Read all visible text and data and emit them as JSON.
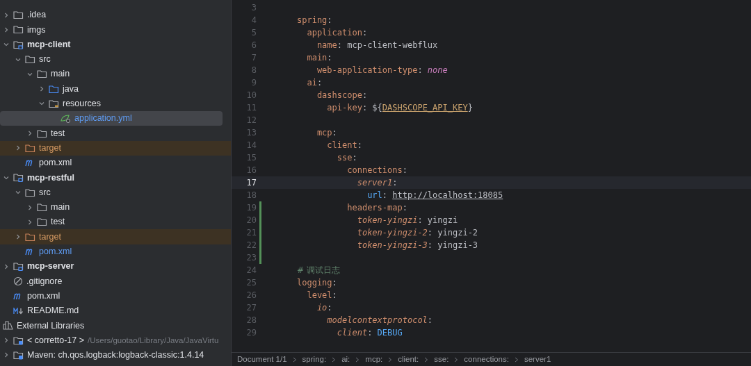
{
  "project_tree": [
    {
      "name": ".idea",
      "kind": "folder",
      "expanded": false
    },
    {
      "name": "imgs",
      "kind": "folder",
      "expanded": false
    },
    {
      "name": "mcp-client",
      "kind": "module",
      "expanded": true,
      "children": [
        {
          "name": "src",
          "kind": "folder",
          "expanded": true,
          "children": [
            {
              "name": "main",
              "kind": "folder",
              "expanded": true,
              "children": [
                {
                  "name": "java",
                  "kind": "source",
                  "expanded": false
                },
                {
                  "name": "resources",
                  "kind": "resources",
                  "expanded": true,
                  "children": [
                    {
                      "name": "application.yml",
                      "kind": "yaml",
                      "selected": true,
                      "modified": true
                    }
                  ]
                }
              ]
            },
            {
              "name": "test",
              "kind": "folder",
              "expanded": false
            }
          ]
        },
        {
          "name": "target",
          "kind": "excluded",
          "expanded": false
        },
        {
          "name": "pom.xml",
          "kind": "maven",
          "selected": false,
          "modified": false
        }
      ]
    },
    {
      "name": "mcp-restful",
      "kind": "module",
      "expanded": true,
      "children": [
        {
          "name": "src",
          "kind": "folder",
          "expanded": true,
          "children": [
            {
              "name": "main",
              "kind": "folder",
              "expanded": false
            },
            {
              "name": "test",
              "kind": "folder",
              "expanded": false
            }
          ]
        },
        {
          "name": "target",
          "kind": "excluded",
          "expanded": false
        },
        {
          "name": "pom.xml",
          "kind": "maven",
          "selected": false,
          "modified": true
        }
      ]
    },
    {
      "name": "mcp-server",
      "kind": "module",
      "expanded": false
    },
    {
      "name": ".gitignore",
      "kind": "ignore",
      "selected": false,
      "modified": false
    },
    {
      "name": "pom.xml",
      "kind": "maven",
      "selected": false,
      "modified": false
    },
    {
      "name": "README.md",
      "kind": "markdown",
      "selected": false,
      "modified": false
    },
    {
      "name": "External Libraries",
      "kind": "libraries"
    },
    {
      "name": "< corretto-17 >",
      "kind": "jdk",
      "expanded": false,
      "note": "/Users/guotao/Library/Java/JavaVirtu"
    },
    {
      "name": "Maven: ch.qos.logback:logback-classic:1.4.14",
      "kind": "library",
      "expanded": false
    }
  ],
  "editor": {
    "lines": [
      {
        "n": "3",
        "current": false,
        "changed": false
      },
      {
        "n": "4",
        "current": false,
        "changed": false,
        "tokens": [
          {
            "kind": "key",
            "text": "spring"
          },
          {
            "kind": "plain",
            "text": ":"
          }
        ],
        "children": [
          {
            "n": "5",
            "current": false,
            "changed": false,
            "tokens": [
              {
                "kind": "key",
                "text": "application"
              },
              {
                "kind": "plain",
                "text": ":"
              }
            ],
            "children": [
              {
                "n": "6",
                "current": false,
                "changed": false,
                "tokens": [
                  {
                    "kind": "key",
                    "text": "name"
                  },
                  {
                    "kind": "plain",
                    "text": ": mcp-client-webflux"
                  }
                ]
              }
            ]
          },
          {
            "n": "7",
            "current": false,
            "changed": false,
            "tokens": [
              {
                "kind": "key",
                "text": "main"
              },
              {
                "kind": "plain",
                "text": ":"
              }
            ],
            "children": [
              {
                "n": "8",
                "current": false,
                "changed": false,
                "tokens": [
                  {
                    "kind": "key",
                    "text": "web-application-type"
                  },
                  {
                    "kind": "plain",
                    "text": ": "
                  },
                  {
                    "kind": "constant",
                    "text": "none"
                  }
                ]
              }
            ]
          },
          {
            "n": "9",
            "current": false,
            "changed": false,
            "tokens": [
              {
                "kind": "key",
                "text": "ai"
              },
              {
                "kind": "plain",
                "text": ":"
              }
            ],
            "children": [
              {
                "n": "10",
                "current": false,
                "changed": false,
                "tokens": [
                  {
                    "kind": "key",
                    "text": "dashscope"
                  },
                  {
                    "kind": "plain",
                    "text": ":"
                  }
                ],
                "children": [
                  {
                    "n": "11",
                    "current": false,
                    "changed": false,
                    "tokens": [
                      {
                        "kind": "key",
                        "text": "api-key"
                      },
                      {
                        "kind": "plain",
                        "text": ": ${"
                      },
                      {
                        "kind": "env",
                        "text": "DASHSCOPE_API_KEY"
                      },
                      {
                        "kind": "plain",
                        "text": "}"
                      }
                    ]
                  }
                ]
              },
              {
                "n": "12",
                "current": false,
                "changed": false
              },
              {
                "n": "13",
                "current": false,
                "changed": false,
                "tokens": [
                  {
                    "kind": "key",
                    "text": "mcp"
                  },
                  {
                    "kind": "plain",
                    "text": ":"
                  }
                ],
                "children": [
                  {
                    "n": "14",
                    "current": false,
                    "changed": false,
                    "tokens": [
                      {
                        "kind": "key",
                        "text": "client"
                      },
                      {
                        "kind": "plain",
                        "text": ":"
                      }
                    ],
                    "children": [
                      {
                        "n": "15",
                        "current": false,
                        "changed": false,
                        "tokens": [
                          {
                            "kind": "key",
                            "text": "sse"
                          },
                          {
                            "kind": "plain",
                            "text": ":"
                          }
                        ],
                        "children": [
                          {
                            "n": "16",
                            "current": false,
                            "changed": false,
                            "tokens": [
                              {
                                "kind": "key",
                                "text": "connections"
                              },
                              {
                                "kind": "plain",
                                "text": ":"
                              }
                            ],
                            "children": [
                              {
                                "n": "17",
                                "current": true,
                                "changed": false,
                                "tokens": [
                                  {
                                    "kind": "italic_key",
                                    "text": "server1"
                                  },
                                  {
                                    "kind": "plain",
                                    "text": ":"
                                  }
                                ],
                                "children": [
                                  {
                                    "n": "18",
                                    "current": false,
                                    "changed": false,
                                    "tokens": [
                                      {
                                        "kind": "property",
                                        "text": "url"
                                      },
                                      {
                                        "kind": "plain",
                                        "text": ": "
                                      },
                                      {
                                        "kind": "link",
                                        "text": "http://localhost:18085"
                                      }
                                    ]
                                  }
                                ]
                              }
                            ]
                          },
                          {
                            "n": "19",
                            "current": false,
                            "changed": true,
                            "tokens": [
                              {
                                "kind": "key",
                                "text": "headers-map"
                              },
                              {
                                "kind": "plain",
                                "text": ":"
                              }
                            ],
                            "children": [
                              {
                                "n": "20",
                                "current": false,
                                "changed": true,
                                "tokens": [
                                  {
                                    "kind": "italic_key",
                                    "text": "token-yingzi"
                                  },
                                  {
                                    "kind": "plain",
                                    "text": ": yingzi"
                                  }
                                ]
                              },
                              {
                                "n": "21",
                                "current": false,
                                "changed": true,
                                "tokens": [
                                  {
                                    "kind": "italic_key",
                                    "text": "token-yingzi-2"
                                  },
                                  {
                                    "kind": "plain",
                                    "text": ": yingzi-2"
                                  }
                                ]
                              },
                              {
                                "n": "22",
                                "current": false,
                                "changed": true,
                                "tokens": [
                                  {
                                    "kind": "italic_key",
                                    "text": "token-yingzi-3"
                                  },
                                  {
                                    "kind": "plain",
                                    "text": ": yingzi-3"
                                  }
                                ]
                              }
                            ]
                          },
                          {
                            "n": "23",
                            "current": false,
                            "changed": true
                          }
                        ]
                      }
                    ]
                  }
                ]
              }
            ]
          }
        ]
      },
      {
        "n": "24",
        "current": false,
        "changed": false,
        "tokens": [
          {
            "kind": "comment",
            "text": "# 调试日志"
          }
        ]
      },
      {
        "n": "25",
        "current": false,
        "changed": false,
        "tokens": [
          {
            "kind": "key",
            "text": "logging"
          },
          {
            "kind": "plain",
            "text": ":"
          }
        ],
        "children": [
          {
            "n": "26",
            "current": false,
            "changed": false,
            "tokens": [
              {
                "kind": "key",
                "text": "level"
              },
              {
                "kind": "plain",
                "text": ":"
              }
            ],
            "children": [
              {
                "n": "27",
                "current": false,
                "changed": false,
                "tokens": [
                  {
                    "kind": "italic_key",
                    "text": "io"
                  },
                  {
                    "kind": "plain",
                    "text": ":"
                  }
                ],
                "children": [
                  {
                    "n": "28",
                    "current": false,
                    "changed": false,
                    "tokens": [
                      {
                        "kind": "italic_key",
                        "text": "modelcontextprotocol"
                      },
                      {
                        "kind": "plain",
                        "text": ":"
                      }
                    ],
                    "children": [
                      {
                        "n": "29",
                        "current": false,
                        "changed": false,
                        "tokens": [
                          {
                            "kind": "italic_key",
                            "text": "client"
                          },
                          {
                            "kind": "plain",
                            "text": ": "
                          },
                          {
                            "kind": "property",
                            "text": "DEBUG"
                          }
                        ]
                      }
                    ]
                  }
                ]
              }
            ]
          }
        ]
      }
    ],
    "breadcrumbs": [
      "Document 1/1",
      "spring:",
      "ai:",
      "mcp:",
      "client:",
      "sse:",
      "connections:",
      "server1"
    ]
  }
}
